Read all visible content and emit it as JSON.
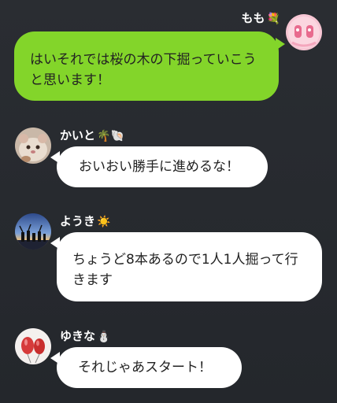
{
  "colors": {
    "background": "#26292e",
    "sent_bubble": "#83d52a",
    "received_bubble": "#ffffff",
    "name_text": "#ffffff",
    "message_text": "#222222"
  },
  "messages": [
    {
      "sender": "もも",
      "sender_emoji": "💐",
      "direction": "sent",
      "avatar_icon": "pink-character-avatar",
      "text": "はいそれでは桜の木の下掘っていこうと思います！"
    },
    {
      "sender": "かいと",
      "sender_emoji": "🌴🐚",
      "direction": "received",
      "avatar_icon": "hamster-avatar",
      "text": "おいおい勝手に進めるな！"
    },
    {
      "sender": "ようき",
      "sender_emoji": "☀️",
      "direction": "received",
      "avatar_icon": "sunset-group-avatar",
      "text": "ちょうど8本あるので1人1人掘って行きます"
    },
    {
      "sender": "ゆきな",
      "sender_emoji": "⛄",
      "direction": "received",
      "avatar_icon": "balloon-avatar",
      "text": "それじゃあスタート！"
    }
  ]
}
